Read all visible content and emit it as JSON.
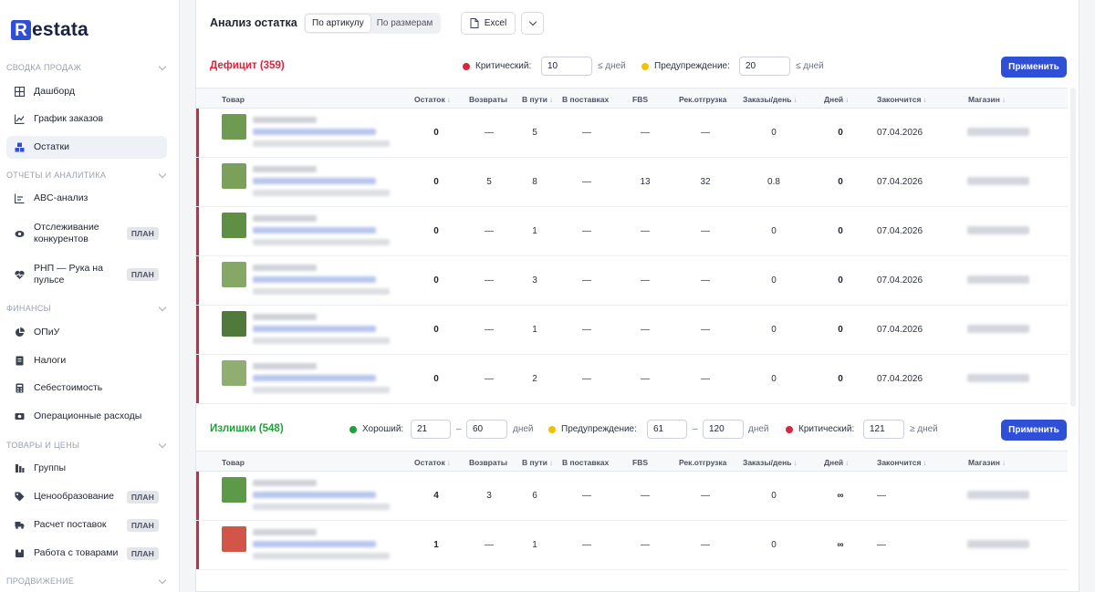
{
  "sidebar": {
    "logo_letter": "R",
    "logo_text": "estata",
    "sections": {
      "sales": "СВОДКА ПРОДАЖ",
      "reports": "ОТЧЕТЫ И АНАЛИТИКА",
      "finance": "ФИНАНСЫ",
      "goods": "ТОВАРЫ И ЦЕНЫ",
      "promo": "ПРОДВИЖЕНИЕ"
    },
    "items": {
      "dashboard": "Дашборд",
      "orders_chart": "График заказов",
      "stock": "Остатки",
      "abc": "ABC-анализ",
      "competitors": "Отслеживание конкурентов",
      "rnp": "РНП — Рука на пульсе",
      "pnl": "ОПиУ",
      "taxes": "Налоги",
      "cost": "Себестоимость",
      "opex": "Операционные расходы",
      "groups": "Группы",
      "pricing": "Ценообразование",
      "supply": "Расчет поставок",
      "products": "Работа с товарами"
    },
    "plan_badge": "ПЛАН"
  },
  "header": {
    "title": "Анализ остатка",
    "tabs": [
      "По артикулу",
      "По размерам"
    ],
    "active_tab": "По артикулу",
    "excel": "Excel"
  },
  "deficit": {
    "title": "Дефицит (359)",
    "critical_label": "Критический:",
    "critical_value": "10",
    "critical_unit": "≤ дней",
    "warning_label": "Предупреждение:",
    "warning_value": "20",
    "warning_unit": "≤ дней",
    "apply": "Применить",
    "rows": [
      {
        "stock": "0",
        "returns": "—",
        "transit": "5",
        "supplies": "—",
        "fbs": "—",
        "rec": "—",
        "orders": "0",
        "days": "0",
        "ends": "07.04.2026"
      },
      {
        "stock": "0",
        "returns": "5",
        "transit": "8",
        "supplies": "—",
        "fbs": "13",
        "rec": "32",
        "orders": "0.8",
        "days": "0",
        "ends": "07.04.2026"
      },
      {
        "stock": "0",
        "returns": "—",
        "transit": "1",
        "supplies": "—",
        "fbs": "—",
        "rec": "—",
        "orders": "0",
        "days": "0",
        "ends": "07.04.2026"
      },
      {
        "stock": "0",
        "returns": "—",
        "transit": "3",
        "supplies": "—",
        "fbs": "—",
        "rec": "—",
        "orders": "0",
        "days": "0",
        "ends": "07.04.2026"
      },
      {
        "stock": "0",
        "returns": "—",
        "transit": "1",
        "supplies": "—",
        "fbs": "—",
        "rec": "—",
        "orders": "0",
        "days": "0",
        "ends": "07.04.2026"
      },
      {
        "stock": "0",
        "returns": "—",
        "transit": "2",
        "supplies": "—",
        "fbs": "—",
        "rec": "—",
        "orders": "0",
        "days": "0",
        "ends": "07.04.2026"
      }
    ]
  },
  "surplus": {
    "title": "Излишки (548)",
    "good_label": "Хороший:",
    "good_from": "21",
    "good_to": "60",
    "warn_label": "Предупреждение:",
    "warn_from": "61",
    "warn_to": "120",
    "crit_label": "Критический:",
    "crit_value": "121",
    "dash": "–",
    "unit": "дней",
    "crit_unit": "≥ дней",
    "apply": "Применить",
    "rows": [
      {
        "stock": "4",
        "returns": "3",
        "transit": "6",
        "supplies": "—",
        "fbs": "—",
        "rec": "—",
        "orders": "0",
        "days": "∞",
        "ends": "—"
      },
      {
        "stock": "1",
        "returns": "—",
        "transit": "1",
        "supplies": "—",
        "fbs": "—",
        "rec": "—",
        "orders": "0",
        "days": "∞",
        "ends": "—"
      }
    ]
  },
  "columns": {
    "product": "Товар",
    "stock": "Остаток",
    "returns": "Возвраты",
    "transit": "В пути",
    "supplies": "В поставках",
    "fbs": "FBS",
    "rec": "Рек.отгрузка",
    "orders": "Заказы/день",
    "days": "Дней",
    "ends": "Закончится",
    "store": "Магазин",
    "sort_arrow": "↓"
  },
  "colors": {
    "accent": "#2f4fd6",
    "deficit": "#d7263d",
    "surplus": "#21a038",
    "warning": "#f2c200"
  }
}
